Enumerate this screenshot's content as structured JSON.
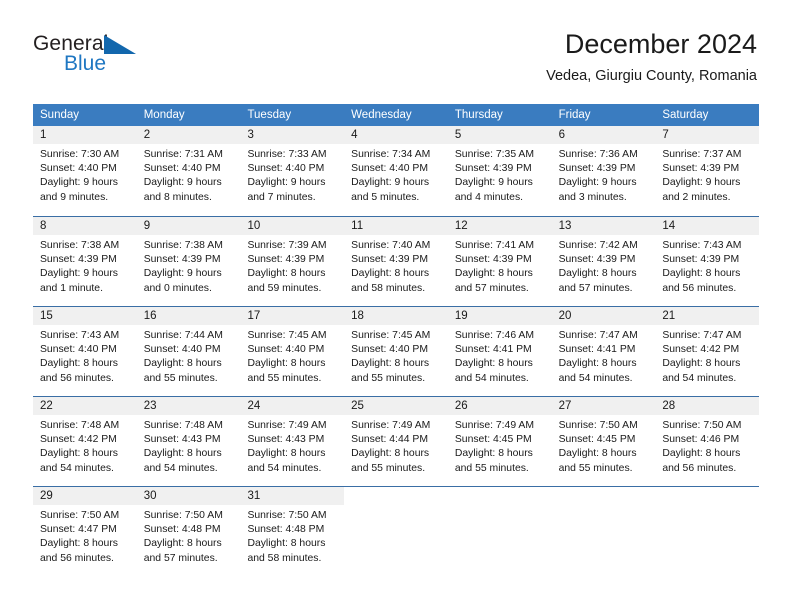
{
  "logo": {
    "word_top": "General",
    "word_bottom": "Blue",
    "triangle_color": "#1267ad",
    "blue_color": "#1f77c2"
  },
  "header": {
    "title": "December 2024",
    "subtitle": "Vedea, Giurgiu County, Romania"
  },
  "theme": {
    "header_bg": "#3a7cc0",
    "row_divider": "#3a6ea5",
    "daynum_bg": "#f0f0f0",
    "cell_bg": "#ffffff",
    "text": "#1a1a1a"
  },
  "weekdays": [
    "Sunday",
    "Monday",
    "Tuesday",
    "Wednesday",
    "Thursday",
    "Friday",
    "Saturday"
  ],
  "weeks": [
    [
      {
        "day": "1",
        "sunrise": "Sunrise: 7:30 AM",
        "sunset": "Sunset: 4:40 PM",
        "daylight1": "Daylight: 9 hours",
        "daylight2": "and 9 minutes."
      },
      {
        "day": "2",
        "sunrise": "Sunrise: 7:31 AM",
        "sunset": "Sunset: 4:40 PM",
        "daylight1": "Daylight: 9 hours",
        "daylight2": "and 8 minutes."
      },
      {
        "day": "3",
        "sunrise": "Sunrise: 7:33 AM",
        "sunset": "Sunset: 4:40 PM",
        "daylight1": "Daylight: 9 hours",
        "daylight2": "and 7 minutes."
      },
      {
        "day": "4",
        "sunrise": "Sunrise: 7:34 AM",
        "sunset": "Sunset: 4:40 PM",
        "daylight1": "Daylight: 9 hours",
        "daylight2": "and 5 minutes."
      },
      {
        "day": "5",
        "sunrise": "Sunrise: 7:35 AM",
        "sunset": "Sunset: 4:39 PM",
        "daylight1": "Daylight: 9 hours",
        "daylight2": "and 4 minutes."
      },
      {
        "day": "6",
        "sunrise": "Sunrise: 7:36 AM",
        "sunset": "Sunset: 4:39 PM",
        "daylight1": "Daylight: 9 hours",
        "daylight2": "and 3 minutes."
      },
      {
        "day": "7",
        "sunrise": "Sunrise: 7:37 AM",
        "sunset": "Sunset: 4:39 PM",
        "daylight1": "Daylight: 9 hours",
        "daylight2": "and 2 minutes."
      }
    ],
    [
      {
        "day": "8",
        "sunrise": "Sunrise: 7:38 AM",
        "sunset": "Sunset: 4:39 PM",
        "daylight1": "Daylight: 9 hours",
        "daylight2": "and 1 minute."
      },
      {
        "day": "9",
        "sunrise": "Sunrise: 7:38 AM",
        "sunset": "Sunset: 4:39 PM",
        "daylight1": "Daylight: 9 hours",
        "daylight2": "and 0 minutes."
      },
      {
        "day": "10",
        "sunrise": "Sunrise: 7:39 AM",
        "sunset": "Sunset: 4:39 PM",
        "daylight1": "Daylight: 8 hours",
        "daylight2": "and 59 minutes."
      },
      {
        "day": "11",
        "sunrise": "Sunrise: 7:40 AM",
        "sunset": "Sunset: 4:39 PM",
        "daylight1": "Daylight: 8 hours",
        "daylight2": "and 58 minutes."
      },
      {
        "day": "12",
        "sunrise": "Sunrise: 7:41 AM",
        "sunset": "Sunset: 4:39 PM",
        "daylight1": "Daylight: 8 hours",
        "daylight2": "and 57 minutes."
      },
      {
        "day": "13",
        "sunrise": "Sunrise: 7:42 AM",
        "sunset": "Sunset: 4:39 PM",
        "daylight1": "Daylight: 8 hours",
        "daylight2": "and 57 minutes."
      },
      {
        "day": "14",
        "sunrise": "Sunrise: 7:43 AM",
        "sunset": "Sunset: 4:39 PM",
        "daylight1": "Daylight: 8 hours",
        "daylight2": "and 56 minutes."
      }
    ],
    [
      {
        "day": "15",
        "sunrise": "Sunrise: 7:43 AM",
        "sunset": "Sunset: 4:40 PM",
        "daylight1": "Daylight: 8 hours",
        "daylight2": "and 56 minutes."
      },
      {
        "day": "16",
        "sunrise": "Sunrise: 7:44 AM",
        "sunset": "Sunset: 4:40 PM",
        "daylight1": "Daylight: 8 hours",
        "daylight2": "and 55 minutes."
      },
      {
        "day": "17",
        "sunrise": "Sunrise: 7:45 AM",
        "sunset": "Sunset: 4:40 PM",
        "daylight1": "Daylight: 8 hours",
        "daylight2": "and 55 minutes."
      },
      {
        "day": "18",
        "sunrise": "Sunrise: 7:45 AM",
        "sunset": "Sunset: 4:40 PM",
        "daylight1": "Daylight: 8 hours",
        "daylight2": "and 55 minutes."
      },
      {
        "day": "19",
        "sunrise": "Sunrise: 7:46 AM",
        "sunset": "Sunset: 4:41 PM",
        "daylight1": "Daylight: 8 hours",
        "daylight2": "and 54 minutes."
      },
      {
        "day": "20",
        "sunrise": "Sunrise: 7:47 AM",
        "sunset": "Sunset: 4:41 PM",
        "daylight1": "Daylight: 8 hours",
        "daylight2": "and 54 minutes."
      },
      {
        "day": "21",
        "sunrise": "Sunrise: 7:47 AM",
        "sunset": "Sunset: 4:42 PM",
        "daylight1": "Daylight: 8 hours",
        "daylight2": "and 54 minutes."
      }
    ],
    [
      {
        "day": "22",
        "sunrise": "Sunrise: 7:48 AM",
        "sunset": "Sunset: 4:42 PM",
        "daylight1": "Daylight: 8 hours",
        "daylight2": "and 54 minutes."
      },
      {
        "day": "23",
        "sunrise": "Sunrise: 7:48 AM",
        "sunset": "Sunset: 4:43 PM",
        "daylight1": "Daylight: 8 hours",
        "daylight2": "and 54 minutes."
      },
      {
        "day": "24",
        "sunrise": "Sunrise: 7:49 AM",
        "sunset": "Sunset: 4:43 PM",
        "daylight1": "Daylight: 8 hours",
        "daylight2": "and 54 minutes."
      },
      {
        "day": "25",
        "sunrise": "Sunrise: 7:49 AM",
        "sunset": "Sunset: 4:44 PM",
        "daylight1": "Daylight: 8 hours",
        "daylight2": "and 55 minutes."
      },
      {
        "day": "26",
        "sunrise": "Sunrise: 7:49 AM",
        "sunset": "Sunset: 4:45 PM",
        "daylight1": "Daylight: 8 hours",
        "daylight2": "and 55 minutes."
      },
      {
        "day": "27",
        "sunrise": "Sunrise: 7:50 AM",
        "sunset": "Sunset: 4:45 PM",
        "daylight1": "Daylight: 8 hours",
        "daylight2": "and 55 minutes."
      },
      {
        "day": "28",
        "sunrise": "Sunrise: 7:50 AM",
        "sunset": "Sunset: 4:46 PM",
        "daylight1": "Daylight: 8 hours",
        "daylight2": "and 56 minutes."
      }
    ],
    [
      {
        "day": "29",
        "sunrise": "Sunrise: 7:50 AM",
        "sunset": "Sunset: 4:47 PM",
        "daylight1": "Daylight: 8 hours",
        "daylight2": "and 56 minutes."
      },
      {
        "day": "30",
        "sunrise": "Sunrise: 7:50 AM",
        "sunset": "Sunset: 4:48 PM",
        "daylight1": "Daylight: 8 hours",
        "daylight2": "and 57 minutes."
      },
      {
        "day": "31",
        "sunrise": "Sunrise: 7:50 AM",
        "sunset": "Sunset: 4:48 PM",
        "daylight1": "Daylight: 8 hours",
        "daylight2": "and 58 minutes."
      },
      null,
      null,
      null,
      null
    ]
  ]
}
